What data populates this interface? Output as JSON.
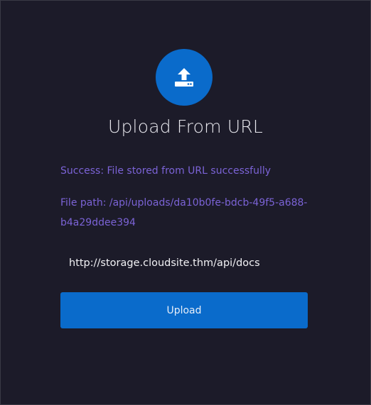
{
  "header": {
    "icon": "upload-icon",
    "title": "Upload From URL"
  },
  "messages": {
    "success": "Success: File stored from URL successfully",
    "file_path": "File path: /api/uploads/da10b0fe-bdcb-49f5-a688-b4a29ddee394"
  },
  "form": {
    "url_value": "http://storage.cloudsite.thm/api/docs",
    "upload_label": "Upload"
  },
  "colors": {
    "background": "#1c1b29",
    "accent": "#0a6bcb",
    "message_text": "#7b63d6",
    "title_text": "#e8e8ee"
  }
}
